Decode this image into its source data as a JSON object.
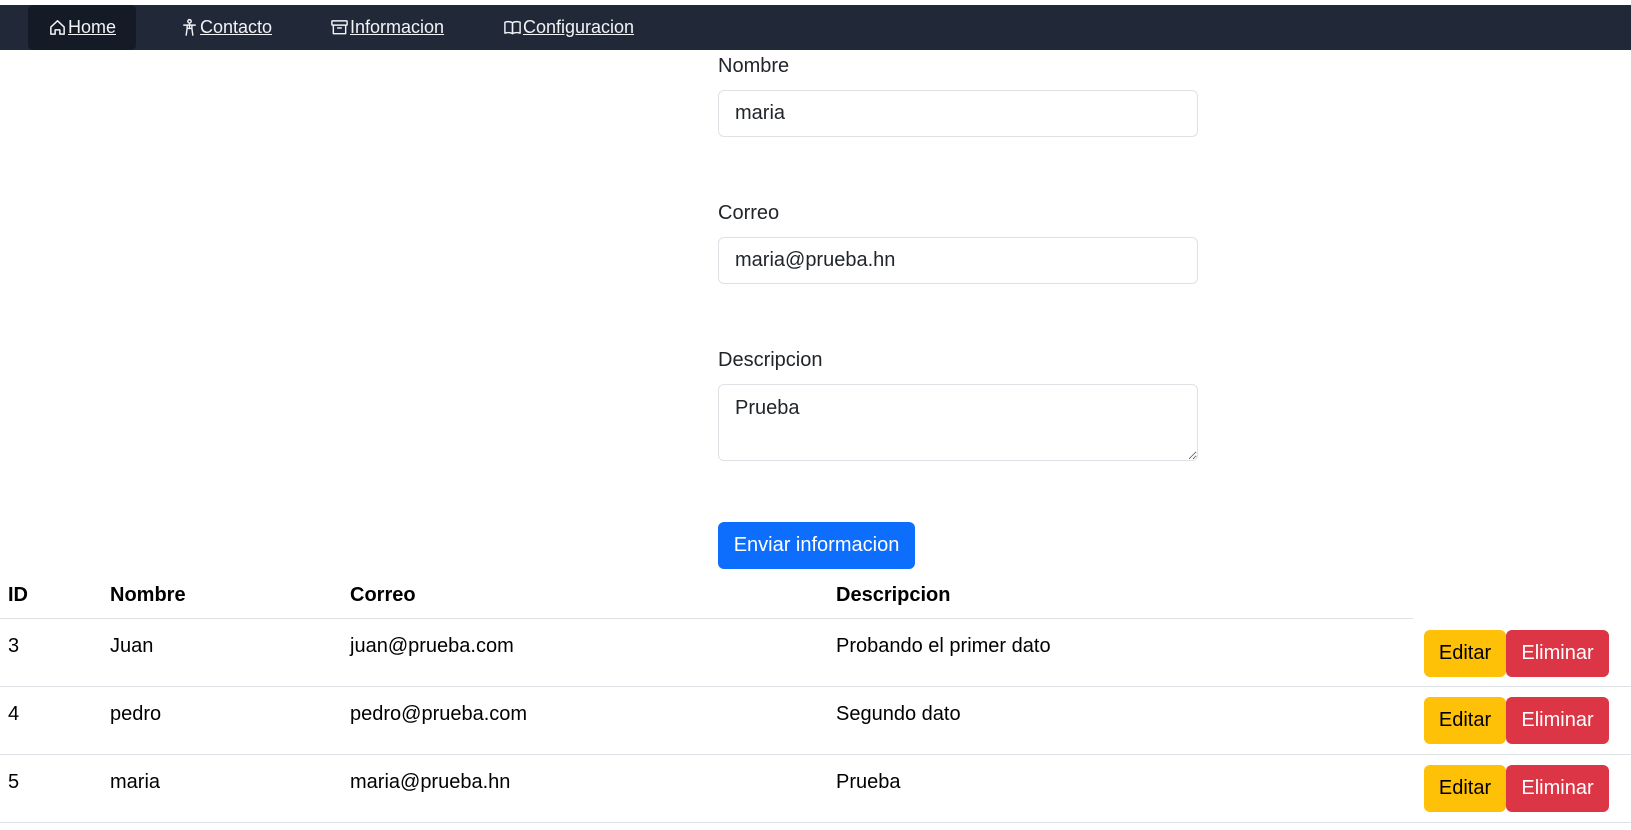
{
  "nav": {
    "items": [
      {
        "label": "Home",
        "icon": "home-icon"
      },
      {
        "label": "Contacto",
        "icon": "person-icon"
      },
      {
        "label": "Informacion",
        "icon": "archive-icon"
      },
      {
        "label": "Configuracion",
        "icon": "book-icon"
      }
    ]
  },
  "form": {
    "nombre_label": "Nombre",
    "nombre_value": "maria",
    "correo_label": "Correo",
    "correo_value": "maria@prueba.hn",
    "descripcion_label": "Descripcion",
    "descripcion_value": "Prueba",
    "submit_label": "Enviar informacion"
  },
  "table": {
    "headers": [
      "ID",
      "Nombre",
      "Correo",
      "Descripcion"
    ],
    "rows": [
      {
        "id": "3",
        "nombre": "Juan",
        "correo": "juan@prueba.com",
        "descripcion": "Probando el primer dato"
      },
      {
        "id": "4",
        "nombre": "pedro",
        "correo": "pedro@prueba.com",
        "descripcion": "Segundo dato"
      },
      {
        "id": "5",
        "nombre": "maria",
        "correo": "maria@prueba.hn",
        "descripcion": "Prueba"
      }
    ],
    "edit_label": "Editar",
    "delete_label": "Eliminar"
  },
  "colors": {
    "navbar": "#212938",
    "primary": "#0d6efd",
    "warning": "#ffc107",
    "danger": "#dc3545"
  }
}
